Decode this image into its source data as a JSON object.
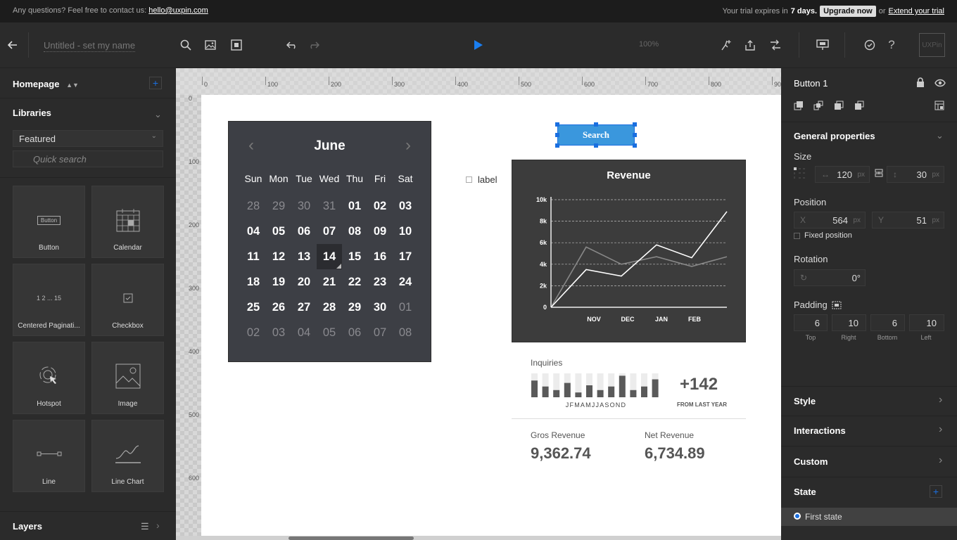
{
  "trial_bar": {
    "contact_text": "Any questions? Feel free to contact us:",
    "email": "hello@uxpin.com",
    "expires_prefix": "Your trial expires in",
    "expires_days": "7 days.",
    "upgrade_label": "Upgrade now",
    "or_text": "or",
    "extend_label": "Extend your trial"
  },
  "toolbar": {
    "doc_title": "Untitled - set my name",
    "zoom": "100%",
    "logo": "UXPin"
  },
  "left_panel": {
    "page_selector": "Homepage",
    "libraries_label": "Libraries",
    "library_select": "Featured",
    "search_placeholder": "Quick search",
    "tiles": [
      {
        "label": "Button",
        "icon_text": "Button"
      },
      {
        "label": "Calendar"
      },
      {
        "label": "Centered Paginati...",
        "icon_text": "1 2 ... 15"
      },
      {
        "label": "Checkbox"
      },
      {
        "label": "Hotspot"
      },
      {
        "label": "Image"
      },
      {
        "label": "Line"
      },
      {
        "label": "Line Chart"
      }
    ],
    "layers_label": "Layers"
  },
  "rulers": {
    "h": [
      "0",
      "100",
      "200",
      "300",
      "400",
      "500",
      "600",
      "700",
      "800",
      "90"
    ],
    "v": [
      "0",
      "100",
      "200",
      "300",
      "400",
      "500",
      "600"
    ]
  },
  "calendar": {
    "month": "June",
    "weekdays": [
      "Sun",
      "Mon",
      "Tue",
      "Wed",
      "Thu",
      "Fri",
      "Sat"
    ],
    "dates": [
      [
        "28",
        "29",
        "30",
        "31",
        "01",
        "02",
        "03"
      ],
      [
        "04",
        "05",
        "06",
        "07",
        "08",
        "09",
        "10"
      ],
      [
        "11",
        "12",
        "13",
        "14",
        "15",
        "16",
        "17"
      ],
      [
        "18",
        "19",
        "20",
        "21",
        "22",
        "23",
        "24"
      ],
      [
        "25",
        "26",
        "27",
        "28",
        "29",
        "30",
        "01"
      ],
      [
        "02",
        "03",
        "04",
        "05",
        "06",
        "07",
        "08"
      ]
    ],
    "selected": "14"
  },
  "checkbox": {
    "label": "label"
  },
  "search_button": {
    "label": "Search"
  },
  "revenue": {
    "title": "Revenue",
    "chart_data": {
      "type": "line",
      "title": "Revenue",
      "categories": [
        "NOV",
        "DEC",
        "JAN",
        "FEB"
      ],
      "y_ticks": [
        "0",
        "2k",
        "4k",
        "6k",
        "8k",
        "10k"
      ],
      "ylim": [
        0,
        10000
      ],
      "grid": true,
      "series": [
        {
          "values": [
            0,
            3500,
            2900,
            5800,
            4600,
            8900
          ],
          "color": "#ffffff"
        },
        {
          "values": [
            0,
            5600,
            4000,
            4700,
            3800,
            4700
          ],
          "color": "#888888"
        }
      ]
    }
  },
  "inquiries": {
    "title": "Inquiries",
    "months": "JFMAMJJASOND",
    "value": "+142",
    "sub": "FROM LAST YEAR",
    "chart_data": {
      "type": "bar",
      "categories": [
        "J",
        "F",
        "M",
        "A",
        "M",
        "J",
        "J",
        "A",
        "S",
        "O",
        "N",
        "D"
      ],
      "values": [
        0.7,
        0.45,
        0.3,
        0.6,
        0.2,
        0.5,
        0.3,
        0.45,
        0.9,
        0.3,
        0.45,
        0.75
      ]
    }
  },
  "totals": {
    "gross_label": "Gros Revenue",
    "gross_value": "9,362.74",
    "net_label": "Net Revenue",
    "net_value": "6,734.89"
  },
  "right_panel": {
    "element_name": "Button 1",
    "general_title": "General properties",
    "size_label": "Size",
    "width": "120",
    "height": "30",
    "unit": "px",
    "position_label": "Position",
    "x_label": "X",
    "x": "564",
    "y_label": "Y",
    "y": "51",
    "fixed_label": "Fixed position",
    "rotation_label": "Rotation",
    "rotation": "0°",
    "padding_label": "Padding",
    "padding": [
      {
        "value": "6",
        "label": "Top"
      },
      {
        "value": "10",
        "label": "Right"
      },
      {
        "value": "6",
        "label": "Bottom"
      },
      {
        "value": "10",
        "label": "Left"
      }
    ],
    "sections": [
      "Style",
      "Interactions",
      "Custom"
    ],
    "state_label": "State",
    "first_state": "First state"
  }
}
